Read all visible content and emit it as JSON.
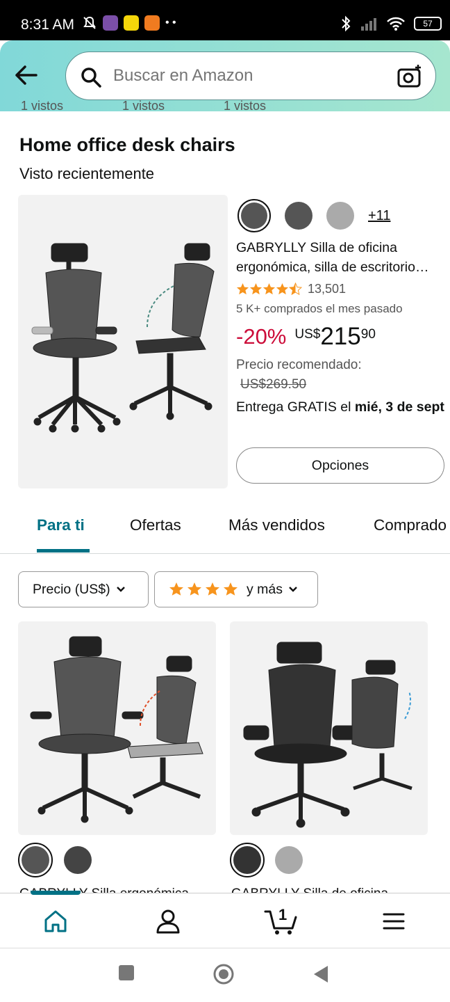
{
  "status": {
    "time": "8:31 AM",
    "battery": "57"
  },
  "search": {
    "placeholder": "Buscar en Amazon"
  },
  "partial_row": [
    "1 vistos",
    "1 vistos",
    "1 vistos"
  ],
  "section": {
    "title": "Home office desk chairs",
    "subtitle": "Visto recientemente"
  },
  "featured": {
    "more_colors": "+11",
    "title_line1": "GABRYLLY Silla de oficina",
    "title_line2": "ergonómica, silla de escritorio…",
    "rating_value": 4.5,
    "rating_count": "13,501",
    "bought": "5 K+ comprados el mes pasado",
    "discount": "-20%",
    "price_currency": "US$",
    "price_whole": "215",
    "price_cents": "90",
    "rec_label": "Precio recomendado:",
    "rec_price": "US$269.50",
    "delivery_prefix": "Entrega GRATIS el ",
    "delivery_date": "mié, 3 de sept",
    "options_button": "Opciones"
  },
  "tabs": [
    "Para ti",
    "Ofertas",
    "Más vendidos",
    "Comprado"
  ],
  "filters": {
    "price": "Precio (US$)",
    "rating_suffix": "y más"
  },
  "grid": [
    {
      "title": "GABRYLLY Silla ergonómica"
    },
    {
      "title": "GABRYLLY Silla de oficina"
    }
  ],
  "cart": {
    "count": "1"
  },
  "colors": {
    "accent": "#007185",
    "discount": "#cc0c39",
    "star": "#f7941d"
  }
}
